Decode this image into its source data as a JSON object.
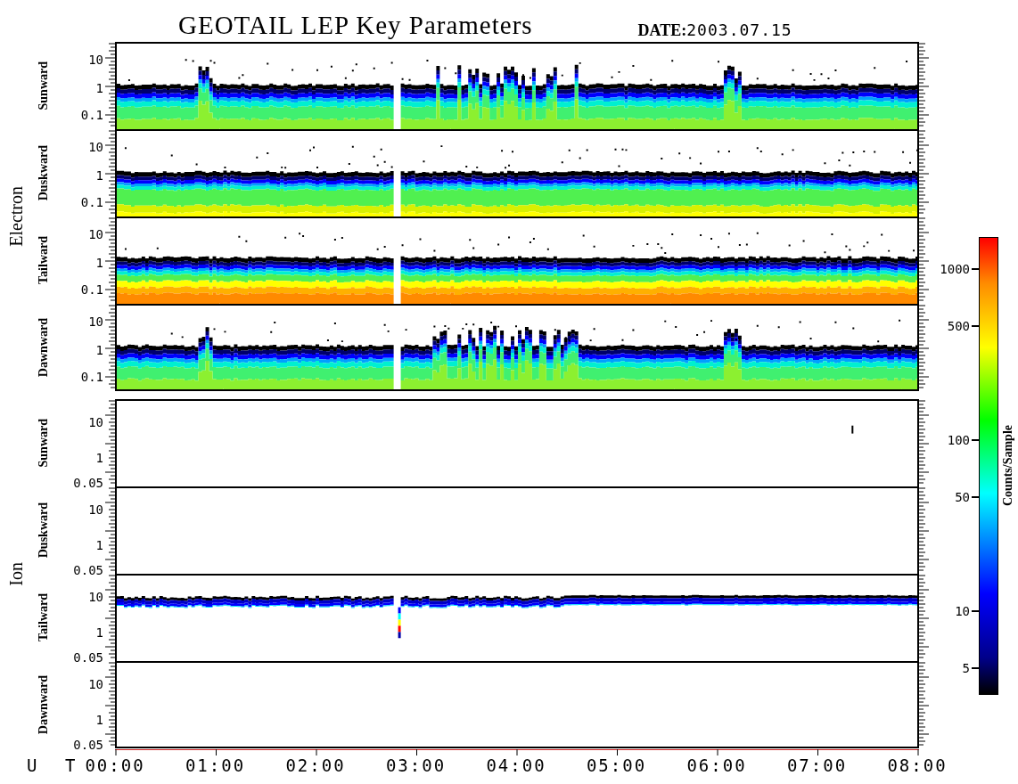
{
  "title": "GEOTAIL LEP Key Parameters",
  "date": {
    "label": "DATE:",
    "value": "2003.07.15"
  },
  "groups": [
    {
      "name": "Electron",
      "panels": [
        {
          "direction": "Sunward",
          "y_labels": [
            "10",
            "1",
            "0.1"
          ],
          "kind": "electron"
        },
        {
          "direction": "Duskward",
          "y_labels": [
            "10",
            "1",
            "0.1"
          ],
          "kind": "electron-dense"
        },
        {
          "direction": "Tailward",
          "y_labels": [
            "10",
            "1",
            "0.1"
          ],
          "kind": "electron-hot"
        },
        {
          "direction": "Dawnward",
          "y_labels": [
            "10",
            "1",
            "0.1"
          ],
          "kind": "electron"
        }
      ]
    },
    {
      "name": "Ion",
      "panels": [
        {
          "direction": "Sunward",
          "y_labels": [
            "10",
            "1",
            "0.05"
          ],
          "kind": "sparse"
        },
        {
          "direction": "Duskward",
          "y_labels": [
            "10",
            "1",
            "0.05"
          ],
          "kind": "blank"
        },
        {
          "direction": "Tailward",
          "y_labels": [
            "10",
            "1",
            "0.05"
          ],
          "kind": "ion-band"
        },
        {
          "direction": "Dawnward",
          "y_labels": [
            "10",
            "1",
            "0.05"
          ],
          "kind": "blank"
        }
      ]
    }
  ],
  "time_axis": {
    "label": "U T",
    "ticks": [
      "00:00",
      "01:00",
      "02:00",
      "03:00",
      "04:00",
      "05:00",
      "06:00",
      "07:00",
      "08:00"
    ]
  },
  "colorbar": {
    "title": "Counts/Sample",
    "ticks": [
      "1000",
      "500",
      "100",
      "50",
      "10",
      "5"
    ]
  }
}
